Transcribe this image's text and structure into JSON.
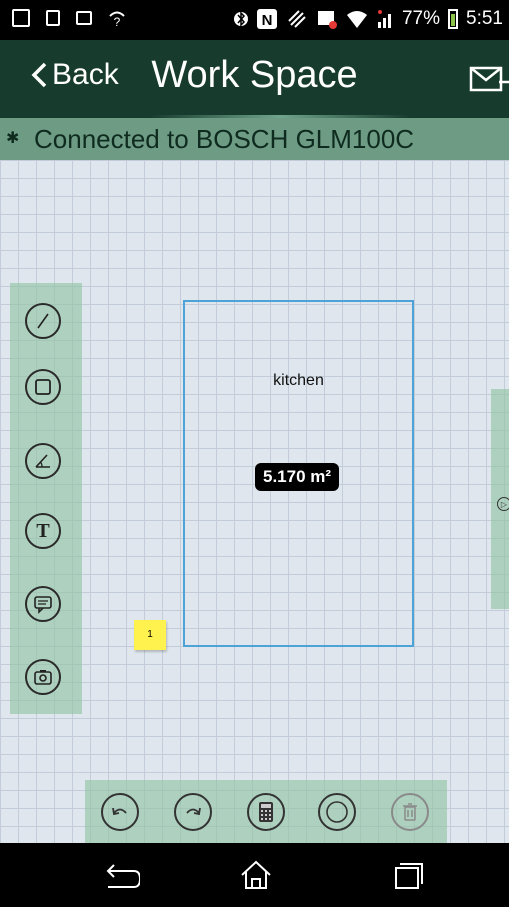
{
  "status_bar": {
    "battery_percent": "77%",
    "time": "5:51",
    "icons": [
      "image-icon",
      "square-icon",
      "copy-icon",
      "wifi-question-icon",
      "bluetooth-icon",
      "nfc-icon",
      "vibrate-icon",
      "data-icon",
      "wifi-icon",
      "signal-icon",
      "battery-icon"
    ]
  },
  "header": {
    "back_label": "Back",
    "title": "Work Space"
  },
  "connection": {
    "text": "Connected to BOSCH GLM100C"
  },
  "toolbar_left": [
    "line-tool-icon",
    "rectangle-tool-icon",
    "angle-tool-icon",
    "text-tool-icon",
    "comment-tool-icon",
    "camera-tool-icon"
  ],
  "room": {
    "label": "kitchen",
    "area": "5.170 m²"
  },
  "sticky_note": {
    "number": "1"
  },
  "bottom_toolbar": [
    "undo-icon",
    "redo-icon",
    "calculator-icon",
    "circle-icon",
    "trash-icon"
  ],
  "nav_bar": [
    "back-nav-icon",
    "home-nav-icon",
    "recents-nav-icon"
  ]
}
